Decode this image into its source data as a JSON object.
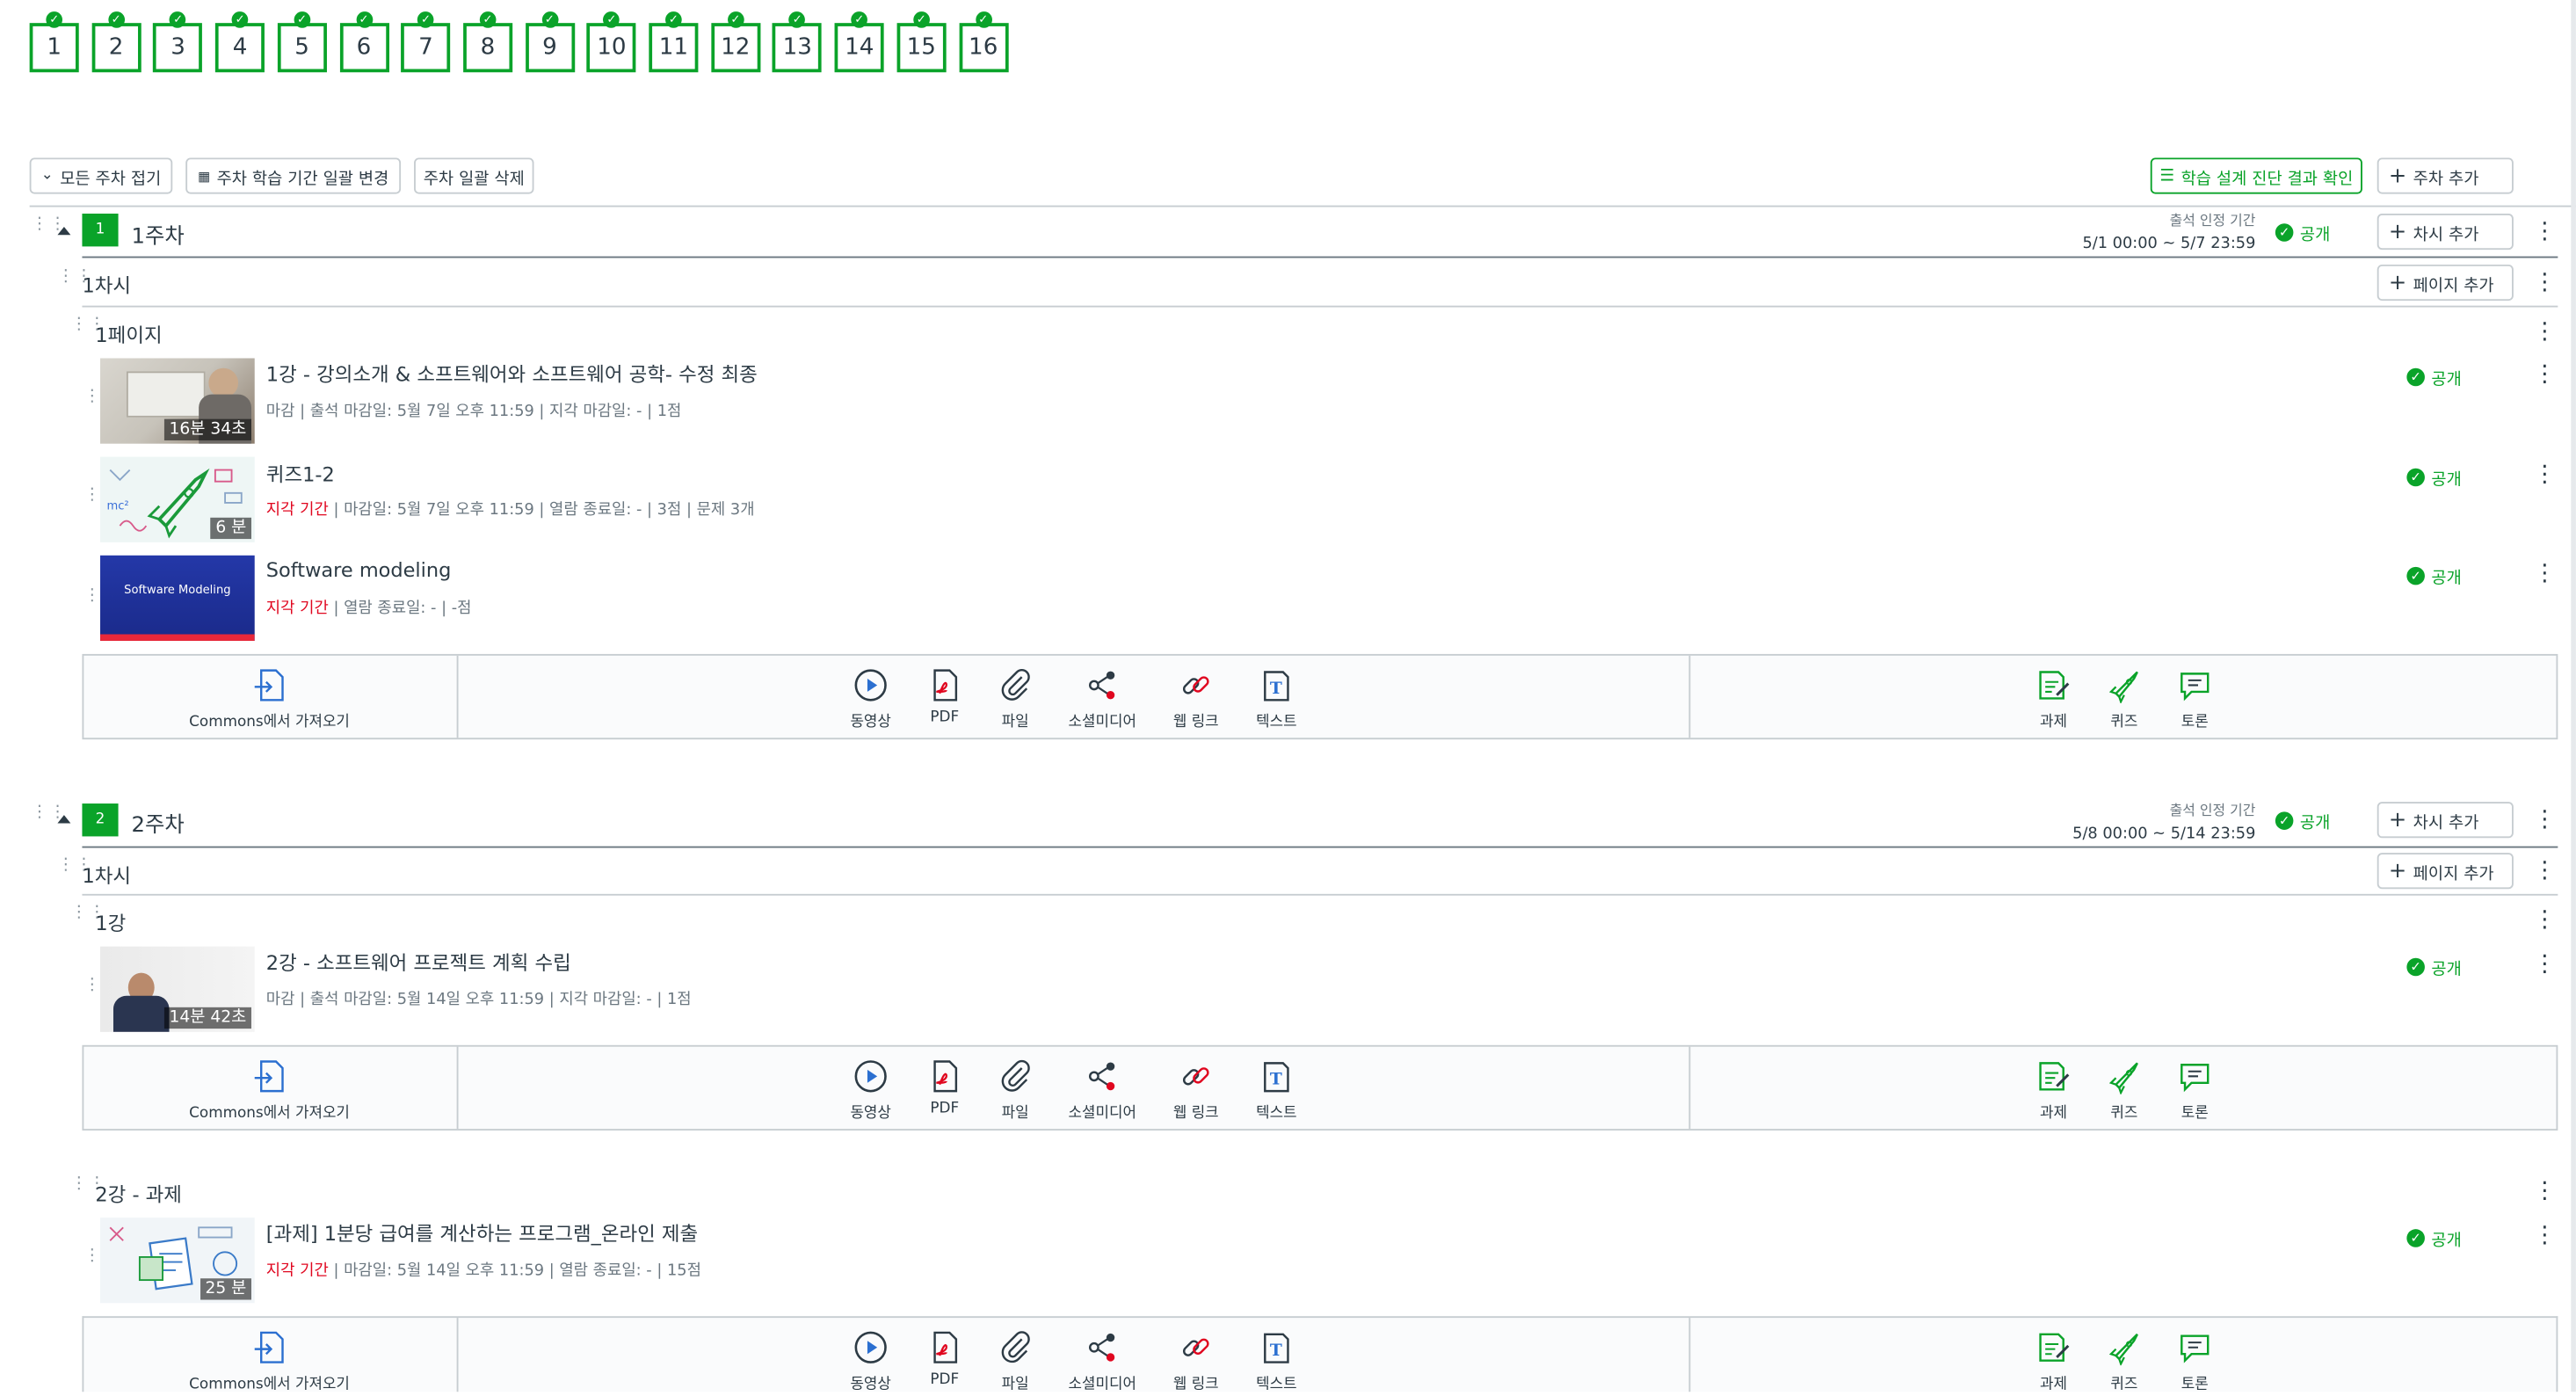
{
  "week_tabs": [
    "1",
    "2",
    "3",
    "4",
    "5",
    "6",
    "7",
    "8",
    "9",
    "10",
    "11",
    "12",
    "13",
    "14",
    "15",
    "16"
  ],
  "toolbar": {
    "collapse_all": "모든 주차 접기",
    "bulk_period": "주차 학습 기간 일괄 변경",
    "bulk_delete": "주차 일괄 삭제",
    "diagnosis": "학습 설계 진단 결과 확인",
    "add_week": "주차 추가"
  },
  "common": {
    "attendance_label": "출석 인정 기간",
    "published": "공개",
    "add_session": "차시 추가",
    "add_page": "페이지 추가",
    "commons_import": "Commons에서 가져오기",
    "tools": {
      "video": "동영상",
      "pdf": "PDF",
      "file": "파일",
      "social": "소셜미디어",
      "weblink": "웹 링크",
      "text": "텍스트",
      "assignment": "과제",
      "quiz": "퀴즈",
      "discussion": "토론"
    }
  },
  "week1": {
    "num": "1",
    "title": "1주차",
    "attendance_period": "5/1 00:00 ~ 5/7 23:59",
    "session": "1차시",
    "page": "1페이지",
    "items": [
      {
        "title": "1강 - 강의소개 & 소프트웨어와 소프트웨어 공학- 수정 최종",
        "duration": "16분 34초",
        "meta_prefix": "마감 | ",
        "meta": "출석 마감일: 5월 7일 오후 11:59  | 지각 마감일: - | 1점"
      },
      {
        "title": "퀴즈1-2",
        "duration": "6 분",
        "late": "지각 기간",
        "meta": " | 마감일: 5월 7일 오후 11:59  | 열람 종료일: - | 3점 | 문제 3개"
      },
      {
        "title": "Software modeling",
        "thumb_text": "Software Modeling",
        "late": "지각 기간",
        "meta": " | 열람 종료일: - | -점"
      }
    ]
  },
  "week2": {
    "num": "2",
    "title": "2주차",
    "attendance_period": "5/8 00:00 ~ 5/14 23:59",
    "session": "1차시",
    "page1": "1강",
    "page2": "2강 - 과제",
    "items": [
      {
        "title": "2강 - 소프트웨어 프로젝트 계획 수립",
        "duration": "14분 42초",
        "meta_prefix": "마감 | ",
        "meta": "출석 마감일: 5월 14일 오후 11:59  | 지각 마감일: - | 1점"
      },
      {
        "title": "[과제] 1분당 급여를 계산하는 프로그램_온라인 제출",
        "duration": "25 분",
        "late": "지각 기간",
        "meta": " | 마감일: 5월 14일 오후 11:59  | 열람 종료일: - | 15점"
      }
    ]
  },
  "colors": {
    "accent": "#0aa329",
    "late": "#e0061f",
    "text": "#2d3b45"
  }
}
